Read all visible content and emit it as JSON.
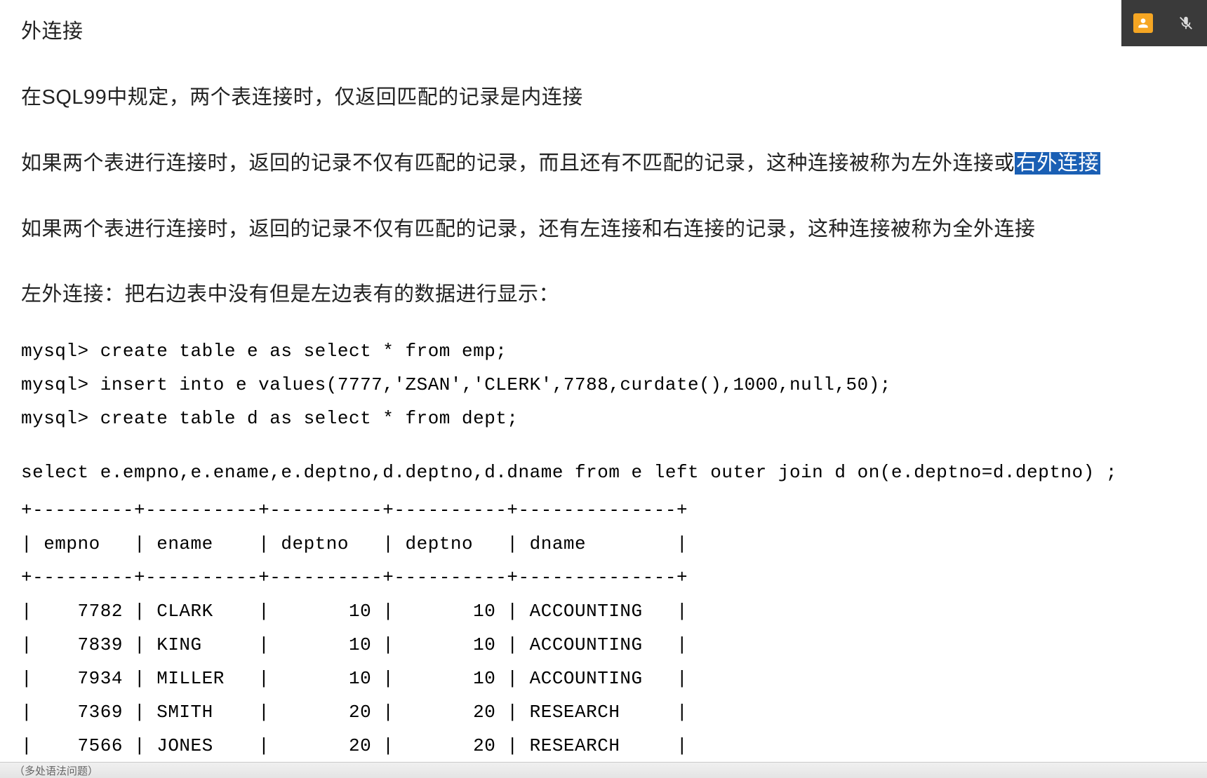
{
  "heading": "外连接",
  "p1": "在SQL99中规定，两个表连接时，仅返回匹配的记录是内连接",
  "p2_before": "如果两个表进行连接时，返回的记录不仅有匹配的记录，而且还有不匹配的记录，这种连接被称为左外连接或",
  "p2_highlight": "右外连接",
  "p3": "如果两个表进行连接时，返回的记录不仅有匹配的记录，还有左连接和右连接的记录，这种连接被称为全外连接",
  "p4": "左外连接：把右边表中没有但是左边表有的数据进行显示：",
  "sql_lines": [
    "mysql> create table e as select * from emp;",
    "mysql> insert into e values(7777,'ZSAN','CLERK',7788,curdate(),1000,null,50);",
    "mysql> create table d as select * from dept;"
  ],
  "query": "select e.empno,e.ename,e.deptno,d.deptno,d.dname from e left outer join d on(e.deptno=d.deptno) ;",
  "chart_data": {
    "type": "table",
    "columns": [
      "empno",
      "ename",
      "deptno",
      "deptno",
      "dname"
    ],
    "rows": [
      [
        7782,
        "CLARK",
        10,
        10,
        "ACCOUNTING"
      ],
      [
        7839,
        "KING",
        10,
        10,
        "ACCOUNTING"
      ],
      [
        7934,
        "MILLER",
        10,
        10,
        "ACCOUNTING"
      ],
      [
        7369,
        "SMITH",
        20,
        20,
        "RESEARCH"
      ],
      [
        7566,
        "JONES",
        20,
        20,
        "RESEARCH"
      ]
    ]
  },
  "overlay": {
    "avatar_icon": "person-icon",
    "mic_icon": "mic-muted-icon"
  },
  "bottom_bar_text": "（多处语法问题）"
}
